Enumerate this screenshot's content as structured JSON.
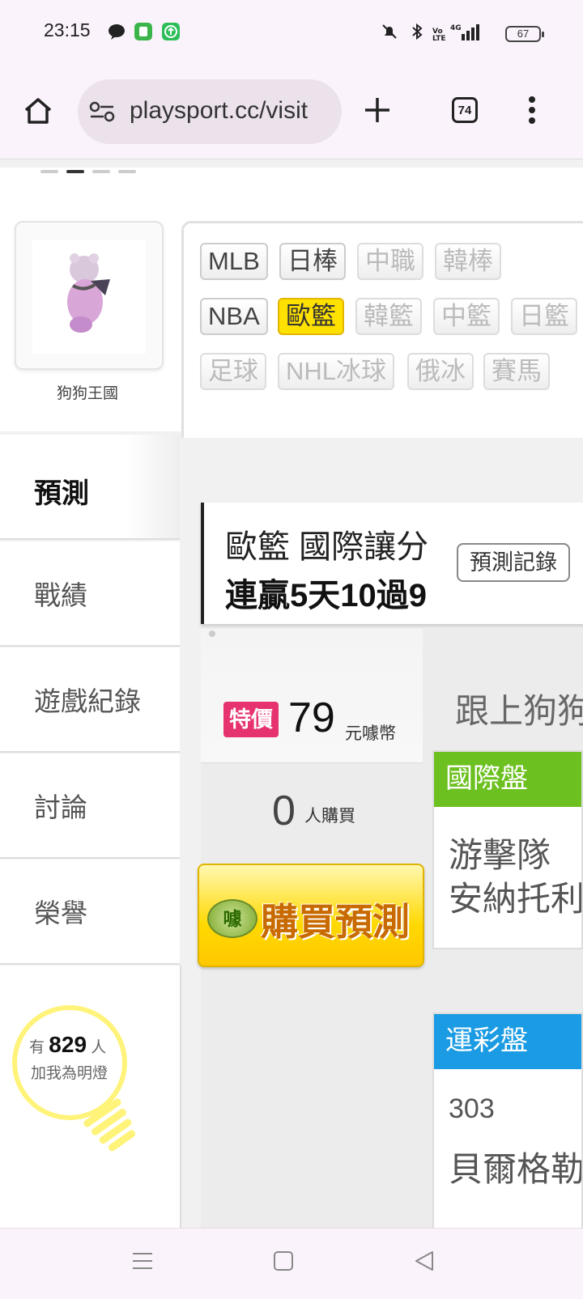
{
  "status_bar": {
    "time": "23:15",
    "battery": "67"
  },
  "browser": {
    "url": "playsport.cc/visit",
    "tab_count": "74"
  },
  "user": {
    "name": "狗狗王國"
  },
  "sidebar": {
    "items": [
      {
        "label": "預測"
      },
      {
        "label": "戰績"
      },
      {
        "label": "遊戲紀錄"
      },
      {
        "label": "討論"
      },
      {
        "label": "榮譽"
      }
    ]
  },
  "categories": {
    "row1": [
      "MLB",
      "日棒",
      "中職",
      "韓棒"
    ],
    "row2": [
      "NBA",
      "歐籃",
      "韓籃",
      "中籃",
      "日籃"
    ],
    "row3": [
      "足球",
      "NHL冰球",
      "俄冰",
      "賽馬"
    ],
    "selected": "歐籃"
  },
  "headline": {
    "line1": "歐籃 國際讓分",
    "line2": "連贏5天10過9",
    "record_button": "預測記錄"
  },
  "price": {
    "badge": "特價",
    "amount": "79",
    "currency": "元噱幣",
    "buyers": "0",
    "buyers_label": "人購買",
    "buy_button": "購買預測",
    "coin_label": "噱"
  },
  "follow_text": "跟上狗狗",
  "panels": [
    {
      "header": "國際盤",
      "color": "#6cc01f",
      "row1": "游擊隊",
      "row2": "安納托利"
    },
    {
      "header": "運彩盤",
      "color": "#1b9be3",
      "row1": "303",
      "row2": "貝爾格勒"
    }
  ],
  "fans": {
    "prefix": "有",
    "count": "829",
    "suffix": "人",
    "line2": "加我為明燈"
  }
}
